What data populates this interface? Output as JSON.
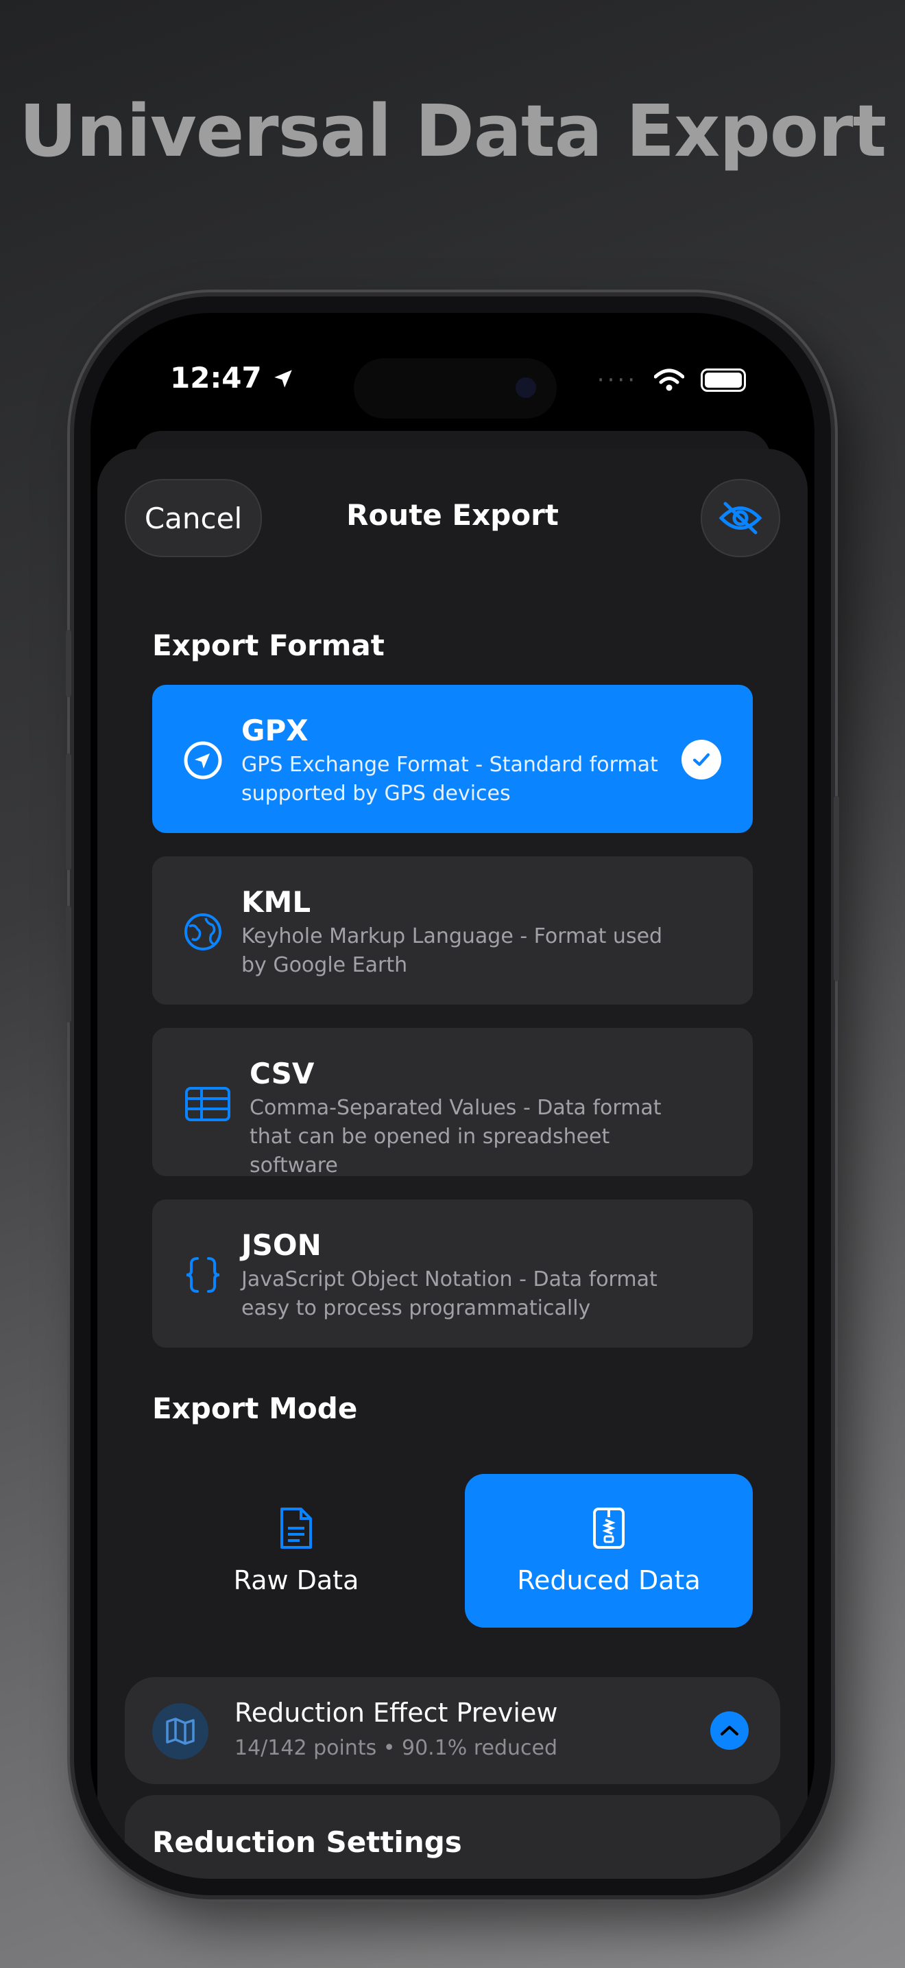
{
  "headline": "Universal Data Export",
  "status_bar": {
    "time": "12:47",
    "signal": "····"
  },
  "sheet": {
    "cancel_label": "Cancel",
    "title": "Route Export"
  },
  "export_format": {
    "label": "Export Format",
    "options": [
      {
        "name": "GPX",
        "description": "GPS Exchange Format - Standard format supported by GPS devices",
        "icon": "navigation-icon",
        "selected": true
      },
      {
        "name": "KML",
        "description": "Keyhole Markup Language - Format used by Google Earth",
        "icon": "globe-icon",
        "selected": false
      },
      {
        "name": "CSV",
        "description": "Comma-Separated Values - Data format that can be opened in spreadsheet software",
        "icon": "table-icon",
        "selected": false
      },
      {
        "name": "JSON",
        "description": "JavaScript Object Notation - Data format easy to process programmatically",
        "icon": "braces-icon",
        "selected": false
      }
    ]
  },
  "export_mode": {
    "label": "Export Mode",
    "raw_label": "Raw Data",
    "reduced_label": "Reduced Data",
    "selected": "reduced"
  },
  "preview": {
    "title": "Reduction Effect Preview",
    "subtitle": "14/142 points • 90.1% reduced"
  },
  "settings": {
    "title": "Reduction Settings"
  },
  "colors": {
    "accent": "#0a84ff",
    "card": "#2c2c2e",
    "sheet": "#1c1c1e"
  }
}
